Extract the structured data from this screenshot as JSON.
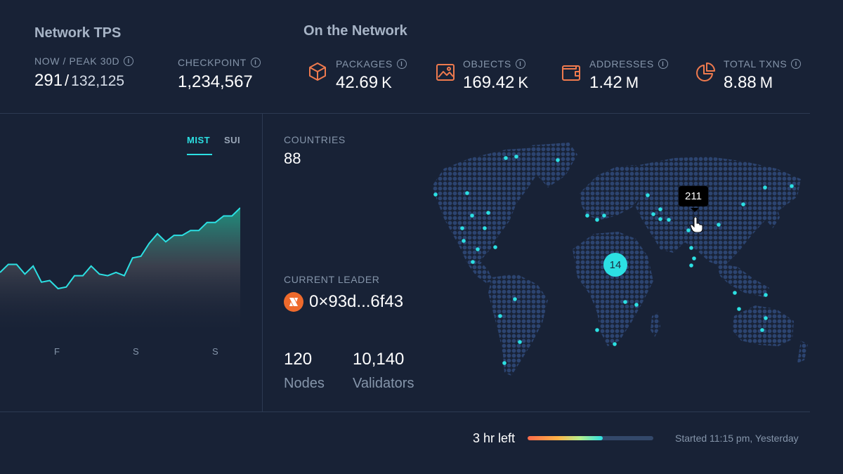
{
  "network_tps": {
    "title": "Network TPS",
    "now_peak_label": "NOW / PEAK 30D",
    "now_value": "291",
    "separator": "/",
    "peak_value": "132,125",
    "checkpoint_label": "CHECKPOINT",
    "checkpoint_value": "1,234,567"
  },
  "on_network": {
    "title": "On the Network",
    "metrics": [
      {
        "label": "PACKAGES",
        "value": "42.69",
        "unit": "K",
        "icon": "box-icon"
      },
      {
        "label": "OBJECTS",
        "value": "169.42",
        "unit": "K",
        "icon": "image-icon"
      },
      {
        "label": "ADDRESSES",
        "value": "1.42",
        "unit": "M",
        "icon": "wallet-icon"
      },
      {
        "label": "TOTAL TXNS",
        "value": "8.88",
        "unit": "M",
        "icon": "pie-icon"
      }
    ]
  },
  "chart": {
    "tabs": [
      "MIST",
      "SUI"
    ],
    "active_tab": "MIST",
    "day_labels": [
      "F",
      "S",
      "S"
    ],
    "line_color": "#2ce0e3"
  },
  "chart_data": {
    "type": "area",
    "x": [
      0,
      1,
      2,
      3,
      4,
      5,
      6,
      7,
      8,
      9,
      10,
      11,
      12,
      13,
      14,
      15,
      16,
      17,
      18,
      19,
      20,
      21,
      22,
      23,
      24,
      25,
      26,
      27,
      28,
      29
    ],
    "values": [
      40,
      45,
      45,
      39,
      44,
      34,
      35,
      30,
      31,
      38,
      38,
      44,
      39,
      38,
      40,
      38,
      49,
      50,
      58,
      64,
      59,
      63,
      63,
      66,
      66,
      71,
      71,
      75,
      75,
      80
    ],
    "ylim": [
      0,
      100
    ],
    "series_color": "#2ce0e3"
  },
  "countries": {
    "label": "COUNTRIES",
    "value": "88"
  },
  "leader": {
    "label": "CURRENT LEADER",
    "address": "0×93d...6f43"
  },
  "nodes": {
    "value": "120",
    "label": "Nodes"
  },
  "validators": {
    "value": "10,140",
    "label": "Validators"
  },
  "map": {
    "cluster_label": "14",
    "tooltip_value": "211",
    "land_color": "#2a4168",
    "highlight_color": "#2ce0e3"
  },
  "epoch": {
    "time_left": "3 hr left",
    "progress": 0.6,
    "started": "Started 11:15 pm, Yesterday"
  }
}
